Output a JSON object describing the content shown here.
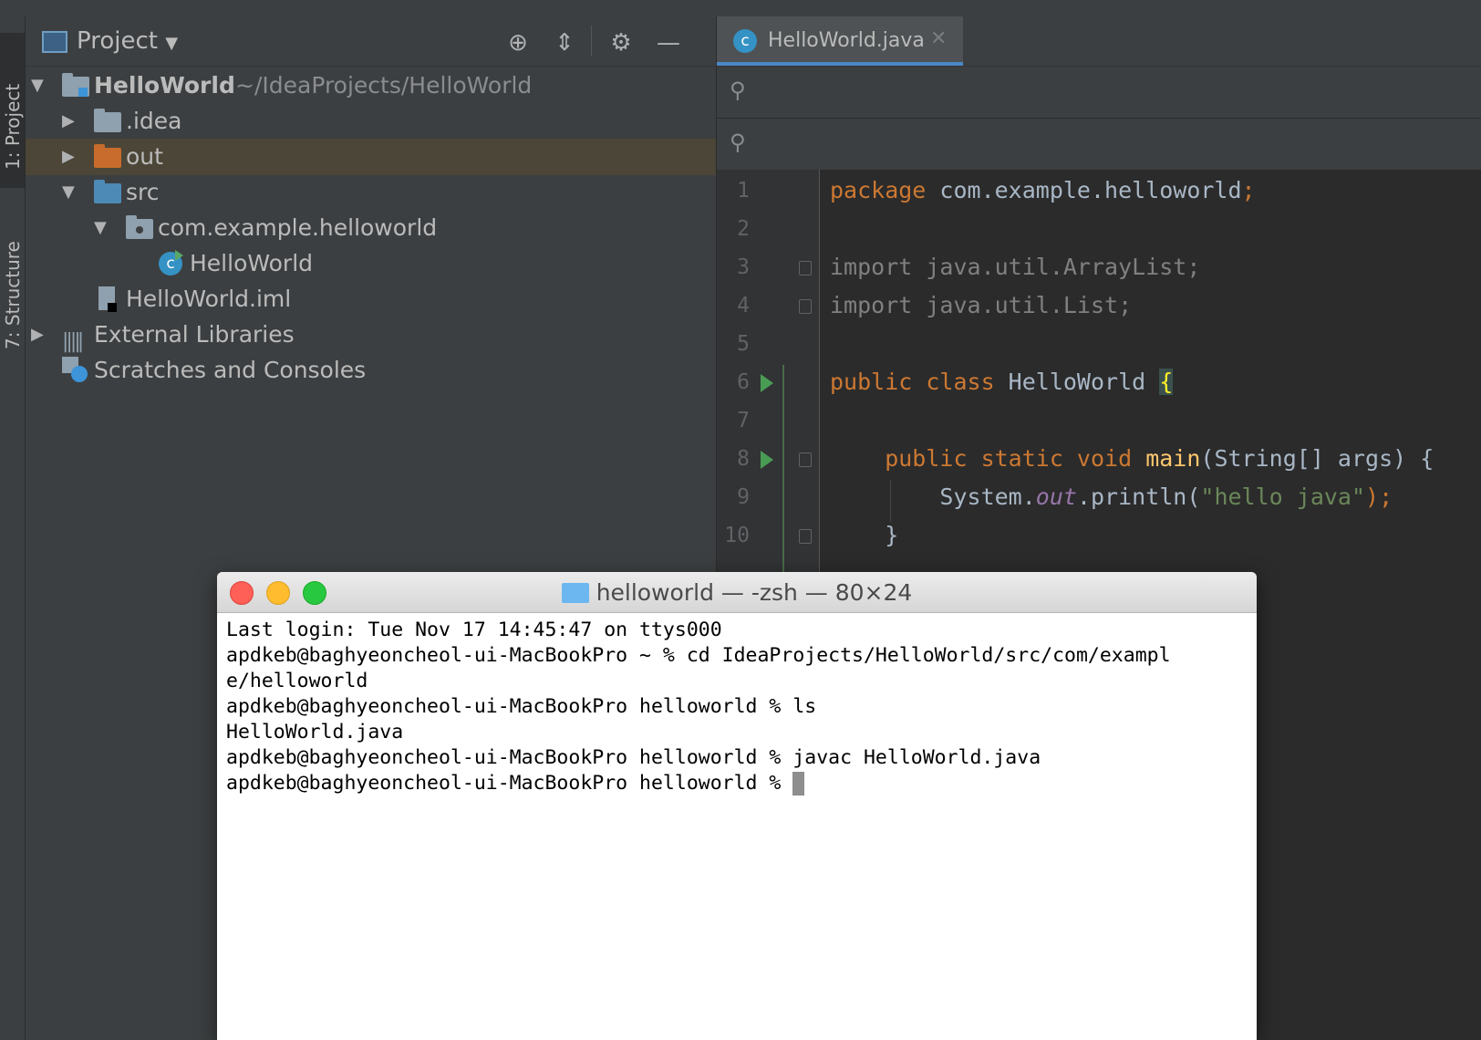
{
  "sidebar": {
    "project_tab": "1: Project",
    "structure_tab": "7: Structure"
  },
  "project_panel": {
    "title": "Project",
    "tree": [
      {
        "label": "HelloWorld",
        "path": "~/IdeaProjects/HelloWorld"
      },
      {
        "label": ".idea"
      },
      {
        "label": "out"
      },
      {
        "label": "src"
      },
      {
        "label": "com.example.helloworld"
      },
      {
        "label": "HelloWorld"
      },
      {
        "label": "HelloWorld.iml"
      },
      {
        "label": "External Libraries"
      },
      {
        "label": "Scratches and Consoles"
      }
    ]
  },
  "editor": {
    "tab_label": "HelloWorld.java",
    "line_numbers": [
      "1",
      "2",
      "3",
      "4",
      "5",
      "6",
      "7",
      "8",
      "9",
      "10"
    ],
    "code": {
      "l1_kw": "package",
      "l1_rest": " com.example.helloworld",
      "l1_semi": ";",
      "l3": "import java.util.ArrayList;",
      "l4": "import java.util.List;",
      "l6_kw": "public class",
      "l6_name": " HelloWorld ",
      "l6_brace": "{",
      "l8_kw": "    public static void",
      "l8_fn": " main",
      "l8_rest": "(String[] args) {",
      "l9_a": "        System.",
      "l9_field": "out",
      "l9_b": ".println(",
      "l9_str": "\"hello java\"",
      "l9_c": ");",
      "l10": "    }"
    }
  },
  "terminal": {
    "title": "helloworld — -zsh — 80×24",
    "lines": [
      "Last login: Tue Nov 17 14:45:47 on ttys000",
      "apdkeb@baghyeoncheol-ui-MacBookPro ~ % cd IdeaProjects/HelloWorld/src/com/exampl",
      "e/helloworld",
      "apdkeb@baghyeoncheol-ui-MacBookPro helloworld % ls",
      "HelloWorld.java",
      "apdkeb@baghyeoncheol-ui-MacBookPro helloworld % javac HelloWorld.java",
      "apdkeb@baghyeoncheol-ui-MacBookPro helloworld % "
    ]
  }
}
